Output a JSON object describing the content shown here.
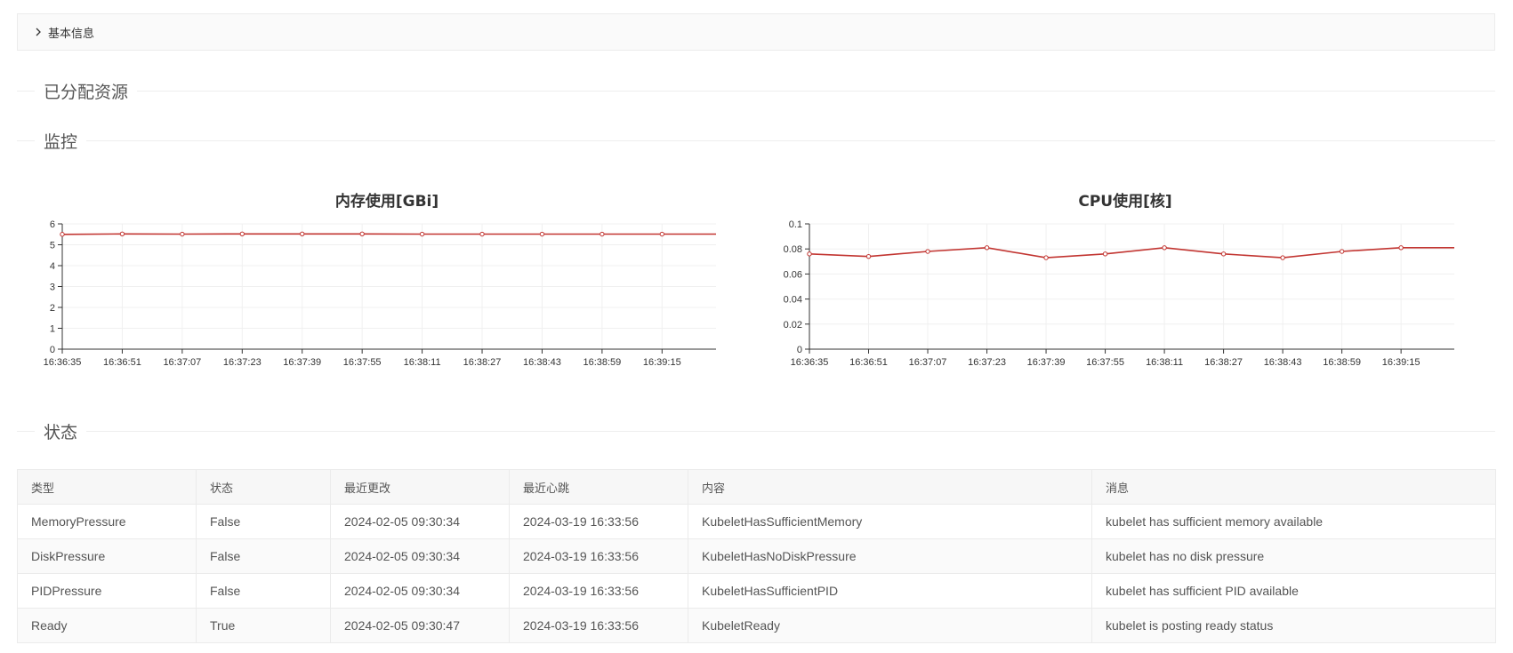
{
  "basic_info": {
    "label": "基本信息"
  },
  "sections": {
    "allocated": "已分配资源",
    "monitor": "监控",
    "status": "状态"
  },
  "chart_data": [
    {
      "type": "line",
      "title": "内存使用[GBi]",
      "x": [
        "16:36:35",
        "16:36:51",
        "16:37:07",
        "16:37:23",
        "16:37:39",
        "16:37:55",
        "16:38:11",
        "16:38:27",
        "16:38:43",
        "16:38:59",
        "16:39:15"
      ],
      "ylim": [
        0,
        6
      ],
      "yticks": [
        "0",
        "1",
        "2",
        "3",
        "4",
        "5",
        "6"
      ],
      "series": [
        {
          "values": [
            5.5,
            5.52,
            5.51,
            5.52,
            5.52,
            5.52,
            5.51,
            5.51,
            5.51,
            5.51,
            5.51
          ]
        }
      ],
      "grid": true,
      "color": "#c23531"
    },
    {
      "type": "line",
      "title": "CPU使用[核]",
      "x": [
        "16:36:35",
        "16:36:51",
        "16:37:07",
        "16:37:23",
        "16:37:39",
        "16:37:55",
        "16:38:11",
        "16:38:27",
        "16:38:43",
        "16:38:59",
        "16:39:15"
      ],
      "ylim": [
        0,
        0.1
      ],
      "yticks": [
        "0",
        "0.02",
        "0.04",
        "0.06",
        "0.08",
        "0.1"
      ],
      "series": [
        {
          "values": [
            0.076,
            0.074,
            0.078,
            0.081,
            0.073,
            0.076,
            0.081,
            0.076,
            0.073,
            0.078,
            0.081
          ]
        }
      ],
      "grid": true,
      "color": "#c23531"
    }
  ],
  "status_table": {
    "headers": [
      "类型",
      "状态",
      "最近更改",
      "最近心跳",
      "内容",
      "消息"
    ],
    "rows": [
      [
        "MemoryPressure",
        "False",
        "2024-02-05 09:30:34",
        "2024-03-19 16:33:56",
        "KubeletHasSufficientMemory",
        "kubelet has sufficient memory available"
      ],
      [
        "DiskPressure",
        "False",
        "2024-02-05 09:30:34",
        "2024-03-19 16:33:56",
        "KubeletHasNoDiskPressure",
        "kubelet has no disk pressure"
      ],
      [
        "PIDPressure",
        "False",
        "2024-02-05 09:30:34",
        "2024-03-19 16:33:56",
        "KubeletHasSufficientPID",
        "kubelet has sufficient PID available"
      ],
      [
        "Ready",
        "True",
        "2024-02-05 09:30:47",
        "2024-03-19 16:33:56",
        "KubeletReady",
        "kubelet is posting ready status"
      ]
    ]
  }
}
